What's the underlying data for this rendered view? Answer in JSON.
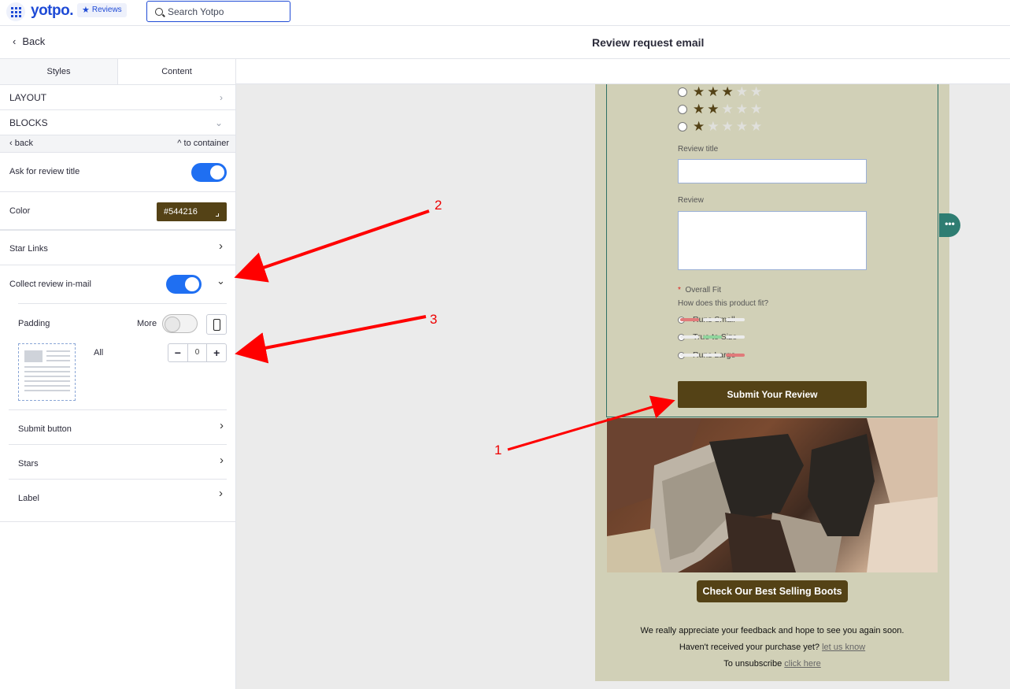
{
  "topbar": {
    "logo": "yotpo.",
    "badge": "Reviews",
    "search_placeholder": "Search Yotpo"
  },
  "header": {
    "back_label": "Back",
    "title": "Review request email"
  },
  "panel": {
    "tabs": [
      {
        "label": "Styles",
        "active": false
      },
      {
        "label": "Content",
        "active": true
      }
    ],
    "layout_label": "LAYOUT",
    "blocks_label": "BLOCKS",
    "subnav_back": "back",
    "subnav_container": "to container",
    "ask_title_label": "Ask for review title",
    "ask_title_on": true,
    "color_label": "Color",
    "color_value": "#544216",
    "star_links_label": "Star Links",
    "collect_label": "Collect review in-mail",
    "collect_on": true,
    "padding_label": "Padding",
    "more_label": "More",
    "more_on": false,
    "all_label": "All",
    "padding_value": "0",
    "submit_button_label": "Submit button",
    "stars_label": "Stars",
    "label_label": "Label"
  },
  "email": {
    "star_options": [
      3,
      2,
      1
    ],
    "review_title_label": "Review title",
    "review_label": "Review",
    "fit_required": "*",
    "fit_title": "Overall Fit",
    "fit_question": "How does this product fit?",
    "fit_options": [
      "Runs Small",
      "True to Size",
      "Runs Large"
    ],
    "submit_label": "Submit Your Review",
    "cta_label": "Check Our Best Selling Boots",
    "footer_line1": "We really appreciate your feedback and hope to see you again soon.",
    "footer_line2": "Haven't received your purchase yet?",
    "footer_link2": "let us know",
    "footer_line3": "To unsubscribe",
    "footer_link3": "click here",
    "dots_button": "•••"
  },
  "annotations": [
    "2",
    "3",
    "1"
  ],
  "colors": {
    "accent": "#1f6ff2",
    "brand": "#1f4bd6",
    "email_bg": "#d1d0b7",
    "button_brown": "#544216",
    "annotation": "#ff0000",
    "fit_red": "#e07a7a",
    "fit_green": "#8fd49c"
  }
}
